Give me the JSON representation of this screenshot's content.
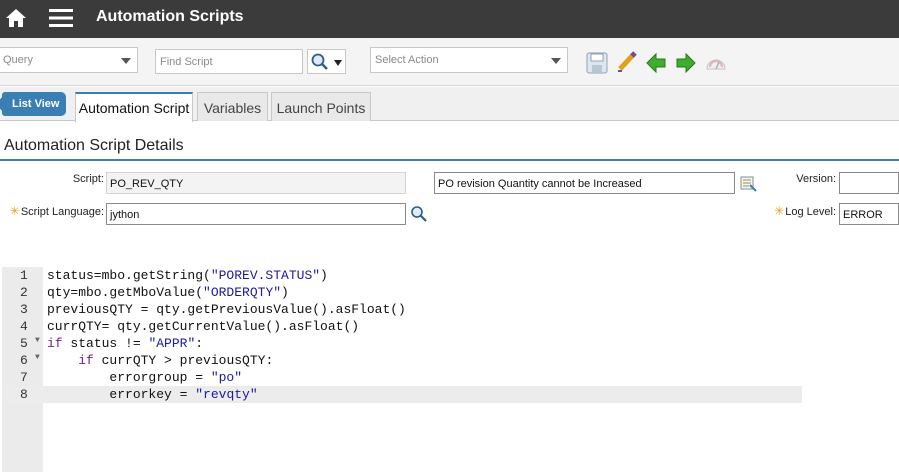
{
  "header": {
    "title": "Automation Scripts"
  },
  "toolbar": {
    "query_placeholder": "Query",
    "find_placeholder": "Find Script",
    "action_placeholder": "Select Action"
  },
  "tabs": {
    "list_view": "List View",
    "items": [
      {
        "label": "Automation Script",
        "active": true
      },
      {
        "label": "Variables",
        "active": false
      },
      {
        "label": "Launch Points",
        "active": false
      }
    ]
  },
  "details": {
    "section_title": "Automation Script Details",
    "script_label": "Script:",
    "script_value": "PO_REV_QTY",
    "description_value": "PO revision Quantity cannot be Increased",
    "version_label": "Version:",
    "version_value": "",
    "language_label": "Script Language:",
    "language_value": "jython",
    "loglevel_label": "Log Level:",
    "loglevel_value": "ERROR"
  },
  "editor": {
    "current_line": 8,
    "lines": [
      {
        "num": "1",
        "fold": false,
        "html": "status=mbo.getString(<span class=\"str\">\"POREV.STATUS\"</span>)"
      },
      {
        "num": "2",
        "fold": false,
        "html": "qty=mbo.getMboValue(<span class=\"str\">\"ORDERQTY\"</span>)"
      },
      {
        "num": "3",
        "fold": false,
        "html": "previousQTY = qty.getPreviousValue().asFloat()"
      },
      {
        "num": "4",
        "fold": false,
        "html": "currQTY= qty.getCurrentValue().asFloat()"
      },
      {
        "num": "5",
        "fold": true,
        "html": "<span class=\"kw\">if</span> status != <span class=\"str\">\"APPR\"</span>:"
      },
      {
        "num": "6",
        "fold": true,
        "html": "    <span class=\"kw\">if</span> currQTY &gt; previousQTY:"
      },
      {
        "num": "7",
        "fold": false,
        "html": "        errorgroup = <span class=\"str\">\"po\"</span>"
      },
      {
        "num": "8",
        "fold": false,
        "html": "        errorkey = <span class=\"str\">\"revqty\"</span>"
      }
    ]
  },
  "colors": {
    "accent": "#3a7fb4",
    "header_bg": "#3b3b3b",
    "required": "#e7a21a"
  }
}
